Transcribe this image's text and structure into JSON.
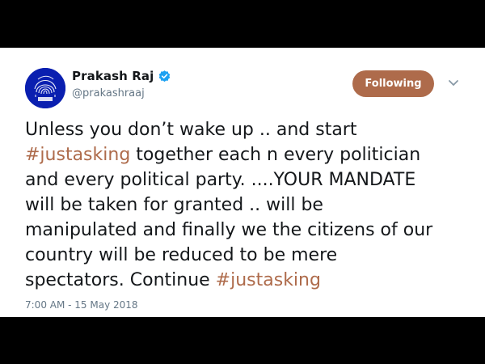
{
  "tweet": {
    "author": {
      "display_name": "Prakash Raj",
      "handle": "@prakashraaj",
      "verified": true,
      "avatar_icon": "fingerprint-logo-icon"
    },
    "follow_button_label": "Following",
    "menu_icon": "chevron-down-icon",
    "text_lines": [
      [
        {
          "t": "Unless you don’t wake up .. and start"
        }
      ],
      [
        {
          "t": "#justasking",
          "hashtag": true
        },
        {
          "t": " together each n every politician"
        }
      ],
      [
        {
          "t": "and every political party. ....YOUR MANDATE"
        }
      ],
      [
        {
          "t": "will be taken for granted .. will be"
        }
      ],
      [
        {
          "t": "manipulated and finally we the citizens of our"
        }
      ],
      [
        {
          "t": "country will be reduced to be mere"
        }
      ],
      [
        {
          "t": "spectators. Continue "
        },
        {
          "t": "#justasking",
          "hashtag": true
        }
      ]
    ],
    "timestamp": "7:00 AM - 15 May 2018"
  },
  "colors": {
    "accent": "#ae6b4b",
    "verified_badge": "#1da1f2",
    "avatar_bg": "#0a1fb0",
    "secondary_text": "#657786",
    "primary_text": "#14171a",
    "letterbox": "#000000"
  }
}
